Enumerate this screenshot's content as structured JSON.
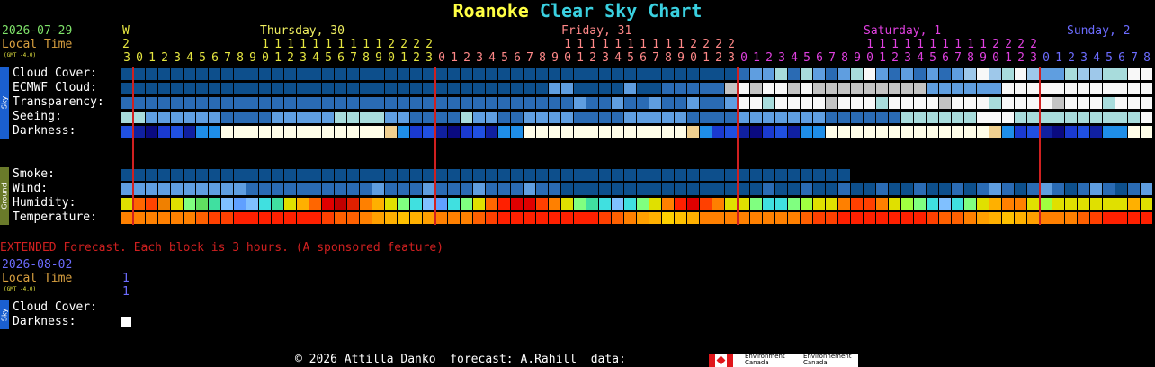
{
  "title": {
    "place": "Roanoke",
    "rest": "Clear Sky Chart",
    "place_color": "#ffff44",
    "rest_color": "#3ad0e0"
  },
  "header": {
    "date": "2026-07-29",
    "local_time": "Local Time",
    "gmt": "(GMT -4.0)",
    "day_letter": "W",
    "day_number": "2",
    "days": [
      {
        "label": "Thursday, 30",
        "color": "#f0f060"
      },
      {
        "label": "Friday, 31",
        "color": "#ff8888"
      },
      {
        "label": "Saturday, 1",
        "color": "#e040e0"
      },
      {
        "label": "Sunday, 2",
        "color": "#6c6cff"
      }
    ],
    "hours": [
      3,
      0,
      1,
      2,
      3,
      4,
      5,
      6,
      7,
      8,
      9,
      0,
      1,
      2,
      3,
      4,
      5,
      6,
      7,
      8,
      9,
      0,
      1,
      2,
      3,
      0,
      1,
      2,
      3,
      4,
      5,
      6,
      7,
      8,
      9,
      0,
      1,
      2,
      3,
      4,
      5,
      6,
      7,
      8,
      9,
      0,
      1,
      2,
      3,
      0,
      1,
      2,
      3,
      4,
      5,
      6,
      7,
      8,
      9,
      0,
      1,
      2,
      3,
      4,
      5,
      6,
      7,
      8,
      9,
      0,
      1,
      2,
      3,
      0,
      1,
      2,
      3,
      4,
      5,
      6,
      7,
      8,
      9,
      0,
      1,
      2,
      3,
      4,
      5,
      6,
      7,
      8,
      9,
      0,
      1,
      2,
      3,
      0,
      1,
      2,
      3,
      4,
      5,
      6,
      7,
      8
    ],
    "tens_digit": "1",
    "twenties_digit": "2"
  },
  "sections": {
    "sky": "Sky",
    "ground": "Ground"
  },
  "rows": {
    "cloud_cover": "Cloud Cover:",
    "ecmwf_cloud": "ECMWF Cloud:",
    "transparency": "Transparency:",
    "seeing": "Seeing:",
    "darkness": "Darkness:",
    "smoke": "Smoke:",
    "wind": "Wind:",
    "humidity": "Humidity:",
    "temperature": "Temperature:"
  },
  "grid": {
    "cloud_cover": "000000000000000000000000000000000000000000000000000000000000000000000000000000000000000000000000000000000000000000000000000000000000000000000000000000000000000000000000000000000000000000000000000000000000000000000000000000000000000000000000000000000000000000000000000000000000000000000000000000000000000000000000000000000000000000000000000000000000000000000000000000000000000000000000000000000000",
    "rows_hex": {
      "cloud": "AAAAAAAAAAAAAAAAAAAAAAAAAAAAAAAAAAAAAAAAAAAAAAAAAAAAAAAAAAAAAAAAAAAAAAAABBBBCDCBBBBBCEBBBCCAAAABBEEAAEBBBEEEECCEECCEEEEEE",
      "ecmwf": "AAAAAAAAAAAAAAAAAAAAAAAAAAAAAAAAAAAAAAAAAAAAAAAAAAAAAAAAAAAAAAAAAAAAAAAAAAAAAAAAAAAAABBAAAAABAAAAAAAAAAFEFEEFEFGGGGGGGGGGGGGGGGGGGCCCCCCCCCEEEEEEEEEEEEEEEEE",
      "transp": "AAAAAAAAAAAAAAAAAAAAAAAAAAAAAAAAAAAAAAAAAAAAAAAAAAAAAAAAAAAAAAAAAAAAAAAAAAAAAAAAAAAAAAAAAAAAAAAAAAAAAAAAAAAAAAAEEFEEEFEEEEEEEEEEEEEEEEEEEEEEEEEEEEEEEE",
      "seeing": "HBBBBBBBBBAAAAAAAAAAAAABBBBHHHBBAAAHHHBBAAAABBBBBAAAABBBBAAAABBBBBBBBAAAAAAAAAHHHHEEEEHHHHHHHHHHHHHHHHHEE"
    }
  },
  "extended": {
    "notice": "EXTENDED Forecast. Each block is 3 hours. (A sponsored feature)",
    "date": "2026-08-02",
    "local_time": "Local Time",
    "gmt": "(GMT -4.0)",
    "hour_top": "1",
    "hour_bottom": "1",
    "cloud_cover": "Cloud Cover:",
    "darkness": "Darkness:"
  },
  "footer": {
    "copyright": "© 2026 Attilla Danko  forecast: A.Rahill  data:",
    "logo_en1": "Environment",
    "logo_en2": "Canada",
    "logo_fr1": "Environnement",
    "logo_fr2": "Canada"
  },
  "colors": {
    "dark_blue": "#0d4f8c",
    "mid_blue": "#2a6bb4",
    "light_blue": "#5f9ee0",
    "pale_blue": "#9ec8ea",
    "teal_pale": "#a8dcdc",
    "white": "#f8f8f8",
    "gray": "#c4c4c4",
    "day_line": "#d02020"
  }
}
